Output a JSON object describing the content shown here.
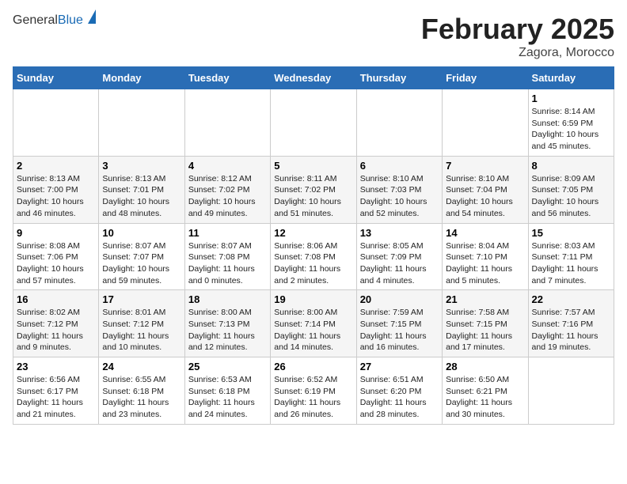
{
  "header": {
    "logo_general": "General",
    "logo_blue": "Blue",
    "title": "February 2025",
    "subtitle": "Zagora, Morocco"
  },
  "days_of_week": [
    "Sunday",
    "Monday",
    "Tuesday",
    "Wednesday",
    "Thursday",
    "Friday",
    "Saturday"
  ],
  "weeks": [
    [
      {
        "day": "",
        "detail": ""
      },
      {
        "day": "",
        "detail": ""
      },
      {
        "day": "",
        "detail": ""
      },
      {
        "day": "",
        "detail": ""
      },
      {
        "day": "",
        "detail": ""
      },
      {
        "day": "",
        "detail": ""
      },
      {
        "day": "1",
        "detail": "Sunrise: 8:14 AM\nSunset: 6:59 PM\nDaylight: 10 hours\nand 45 minutes."
      }
    ],
    [
      {
        "day": "2",
        "detail": "Sunrise: 8:13 AM\nSunset: 7:00 PM\nDaylight: 10 hours\nand 46 minutes."
      },
      {
        "day": "3",
        "detail": "Sunrise: 8:13 AM\nSunset: 7:01 PM\nDaylight: 10 hours\nand 48 minutes."
      },
      {
        "day": "4",
        "detail": "Sunrise: 8:12 AM\nSunset: 7:02 PM\nDaylight: 10 hours\nand 49 minutes."
      },
      {
        "day": "5",
        "detail": "Sunrise: 8:11 AM\nSunset: 7:02 PM\nDaylight: 10 hours\nand 51 minutes."
      },
      {
        "day": "6",
        "detail": "Sunrise: 8:10 AM\nSunset: 7:03 PM\nDaylight: 10 hours\nand 52 minutes."
      },
      {
        "day": "7",
        "detail": "Sunrise: 8:10 AM\nSunset: 7:04 PM\nDaylight: 10 hours\nand 54 minutes."
      },
      {
        "day": "8",
        "detail": "Sunrise: 8:09 AM\nSunset: 7:05 PM\nDaylight: 10 hours\nand 56 minutes."
      }
    ],
    [
      {
        "day": "9",
        "detail": "Sunrise: 8:08 AM\nSunset: 7:06 PM\nDaylight: 10 hours\nand 57 minutes."
      },
      {
        "day": "10",
        "detail": "Sunrise: 8:07 AM\nSunset: 7:07 PM\nDaylight: 10 hours\nand 59 minutes."
      },
      {
        "day": "11",
        "detail": "Sunrise: 8:07 AM\nSunset: 7:08 PM\nDaylight: 11 hours\nand 0 minutes."
      },
      {
        "day": "12",
        "detail": "Sunrise: 8:06 AM\nSunset: 7:08 PM\nDaylight: 11 hours\nand 2 minutes."
      },
      {
        "day": "13",
        "detail": "Sunrise: 8:05 AM\nSunset: 7:09 PM\nDaylight: 11 hours\nand 4 minutes."
      },
      {
        "day": "14",
        "detail": "Sunrise: 8:04 AM\nSunset: 7:10 PM\nDaylight: 11 hours\nand 5 minutes."
      },
      {
        "day": "15",
        "detail": "Sunrise: 8:03 AM\nSunset: 7:11 PM\nDaylight: 11 hours\nand 7 minutes."
      }
    ],
    [
      {
        "day": "16",
        "detail": "Sunrise: 8:02 AM\nSunset: 7:12 PM\nDaylight: 11 hours\nand 9 minutes."
      },
      {
        "day": "17",
        "detail": "Sunrise: 8:01 AM\nSunset: 7:12 PM\nDaylight: 11 hours\nand 10 minutes."
      },
      {
        "day": "18",
        "detail": "Sunrise: 8:00 AM\nSunset: 7:13 PM\nDaylight: 11 hours\nand 12 minutes."
      },
      {
        "day": "19",
        "detail": "Sunrise: 8:00 AM\nSunset: 7:14 PM\nDaylight: 11 hours\nand 14 minutes."
      },
      {
        "day": "20",
        "detail": "Sunrise: 7:59 AM\nSunset: 7:15 PM\nDaylight: 11 hours\nand 16 minutes."
      },
      {
        "day": "21",
        "detail": "Sunrise: 7:58 AM\nSunset: 7:15 PM\nDaylight: 11 hours\nand 17 minutes."
      },
      {
        "day": "22",
        "detail": "Sunrise: 7:57 AM\nSunset: 7:16 PM\nDaylight: 11 hours\nand 19 minutes."
      }
    ],
    [
      {
        "day": "23",
        "detail": "Sunrise: 6:56 AM\nSunset: 6:17 PM\nDaylight: 11 hours\nand 21 minutes."
      },
      {
        "day": "24",
        "detail": "Sunrise: 6:55 AM\nSunset: 6:18 PM\nDaylight: 11 hours\nand 23 minutes."
      },
      {
        "day": "25",
        "detail": "Sunrise: 6:53 AM\nSunset: 6:18 PM\nDaylight: 11 hours\nand 24 minutes."
      },
      {
        "day": "26",
        "detail": "Sunrise: 6:52 AM\nSunset: 6:19 PM\nDaylight: 11 hours\nand 26 minutes."
      },
      {
        "day": "27",
        "detail": "Sunrise: 6:51 AM\nSunset: 6:20 PM\nDaylight: 11 hours\nand 28 minutes."
      },
      {
        "day": "28",
        "detail": "Sunrise: 6:50 AM\nSunset: 6:21 PM\nDaylight: 11 hours\nand 30 minutes."
      },
      {
        "day": "",
        "detail": ""
      }
    ]
  ]
}
